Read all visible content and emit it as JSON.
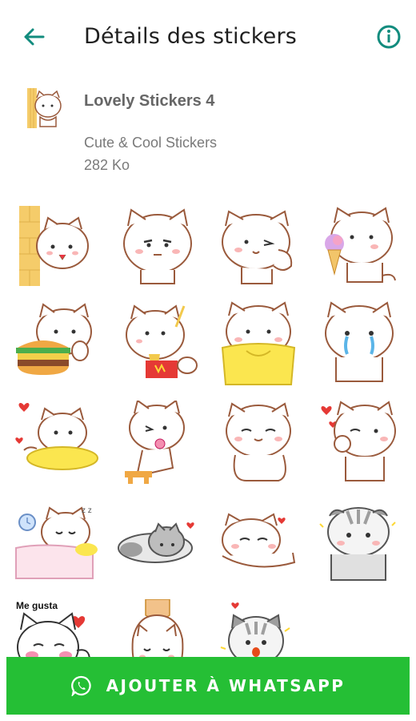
{
  "header": {
    "title": "Détails des stickers",
    "back_icon": "arrow-back-icon",
    "info_icon": "info-icon"
  },
  "pack": {
    "name": "Lovely Stickers 4",
    "subtitle": "Cute & Cool Stickers",
    "size": "282 Ko"
  },
  "stickers": [
    {
      "name": "cat-peeking-wall"
    },
    {
      "name": "cat-annoyed"
    },
    {
      "name": "cat-winking"
    },
    {
      "name": "cat-ice-cream"
    },
    {
      "name": "cat-burger"
    },
    {
      "name": "cat-fries"
    },
    {
      "name": "cat-blanket"
    },
    {
      "name": "cat-crying"
    },
    {
      "name": "cat-pillow-hearts"
    },
    {
      "name": "cat-lollipop"
    },
    {
      "name": "cat-sleepy-smile"
    },
    {
      "name": "cat-blowing-kiss"
    },
    {
      "name": "cat-sleeping-bed"
    },
    {
      "name": "cat-grey-lying"
    },
    {
      "name": "cat-lying-heart"
    },
    {
      "name": "cat-grey-sad"
    },
    {
      "name": "cat-me-gusta",
      "caption": "Me gusta"
    },
    {
      "name": "cat-held-hand"
    },
    {
      "name": "cat-grey-surprised"
    }
  ],
  "add_button": {
    "label": "AJOUTER À WHATSAPP",
    "icon": "whatsapp-icon"
  },
  "colors": {
    "accent": "#128c7e",
    "button": "#25bf35",
    "cat_outline": "#9a5a3c",
    "blush": "#f9b6b6"
  }
}
